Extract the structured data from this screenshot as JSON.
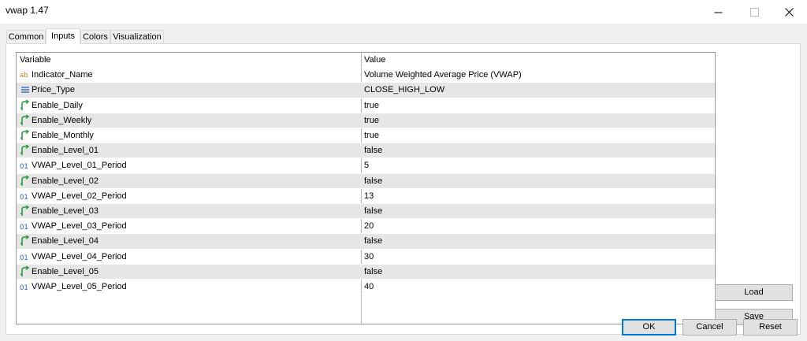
{
  "window": {
    "title": "vwap 1.47"
  },
  "tabs": [
    {
      "label": "Common"
    },
    {
      "label": "Inputs"
    },
    {
      "label": "Colors"
    },
    {
      "label": "Visualization"
    }
  ],
  "grid": {
    "headers": {
      "variable": "Variable",
      "value": "Value"
    },
    "rows": [
      {
        "icon": "string-icon",
        "name": "Indicator_Name",
        "value": "Volume Weighted Average Price (VWAP)"
      },
      {
        "icon": "enum-icon",
        "name": "Price_Type",
        "value": "CLOSE_HIGH_LOW"
      },
      {
        "icon": "bool-icon",
        "name": "Enable_Daily",
        "value": "true"
      },
      {
        "icon": "bool-icon",
        "name": "Enable_Weekly",
        "value": "true"
      },
      {
        "icon": "bool-icon",
        "name": "Enable_Monthly",
        "value": "true"
      },
      {
        "icon": "bool-icon",
        "name": "Enable_Level_01",
        "value": "false"
      },
      {
        "icon": "int-icon",
        "name": "VWAP_Level_01_Period",
        "value": "5"
      },
      {
        "icon": "bool-icon",
        "name": "Enable_Level_02",
        "value": "false"
      },
      {
        "icon": "int-icon",
        "name": "VWAP_Level_02_Period",
        "value": "13"
      },
      {
        "icon": "bool-icon",
        "name": "Enable_Level_03",
        "value": "false"
      },
      {
        "icon": "int-icon",
        "name": "VWAP_Level_03_Period",
        "value": "20"
      },
      {
        "icon": "bool-icon",
        "name": "Enable_Level_04",
        "value": "false"
      },
      {
        "icon": "int-icon",
        "name": "VWAP_Level_04_Period",
        "value": "30"
      },
      {
        "icon": "bool-icon",
        "name": "Enable_Level_05",
        "value": "false"
      },
      {
        "icon": "int-icon",
        "name": "VWAP_Level_05_Period",
        "value": "40"
      }
    ]
  },
  "side_buttons": {
    "load": "Load",
    "save": "Save"
  },
  "footer_buttons": {
    "ok": "OK",
    "cancel": "Cancel",
    "reset": "Reset"
  },
  "colors": {
    "bool_icon": "#2e9a3c",
    "int_icon": "#2a5fb3",
    "string_icon": "#c98a1a",
    "enum_icon": "#3a69b8",
    "accent": "#0078d7"
  }
}
